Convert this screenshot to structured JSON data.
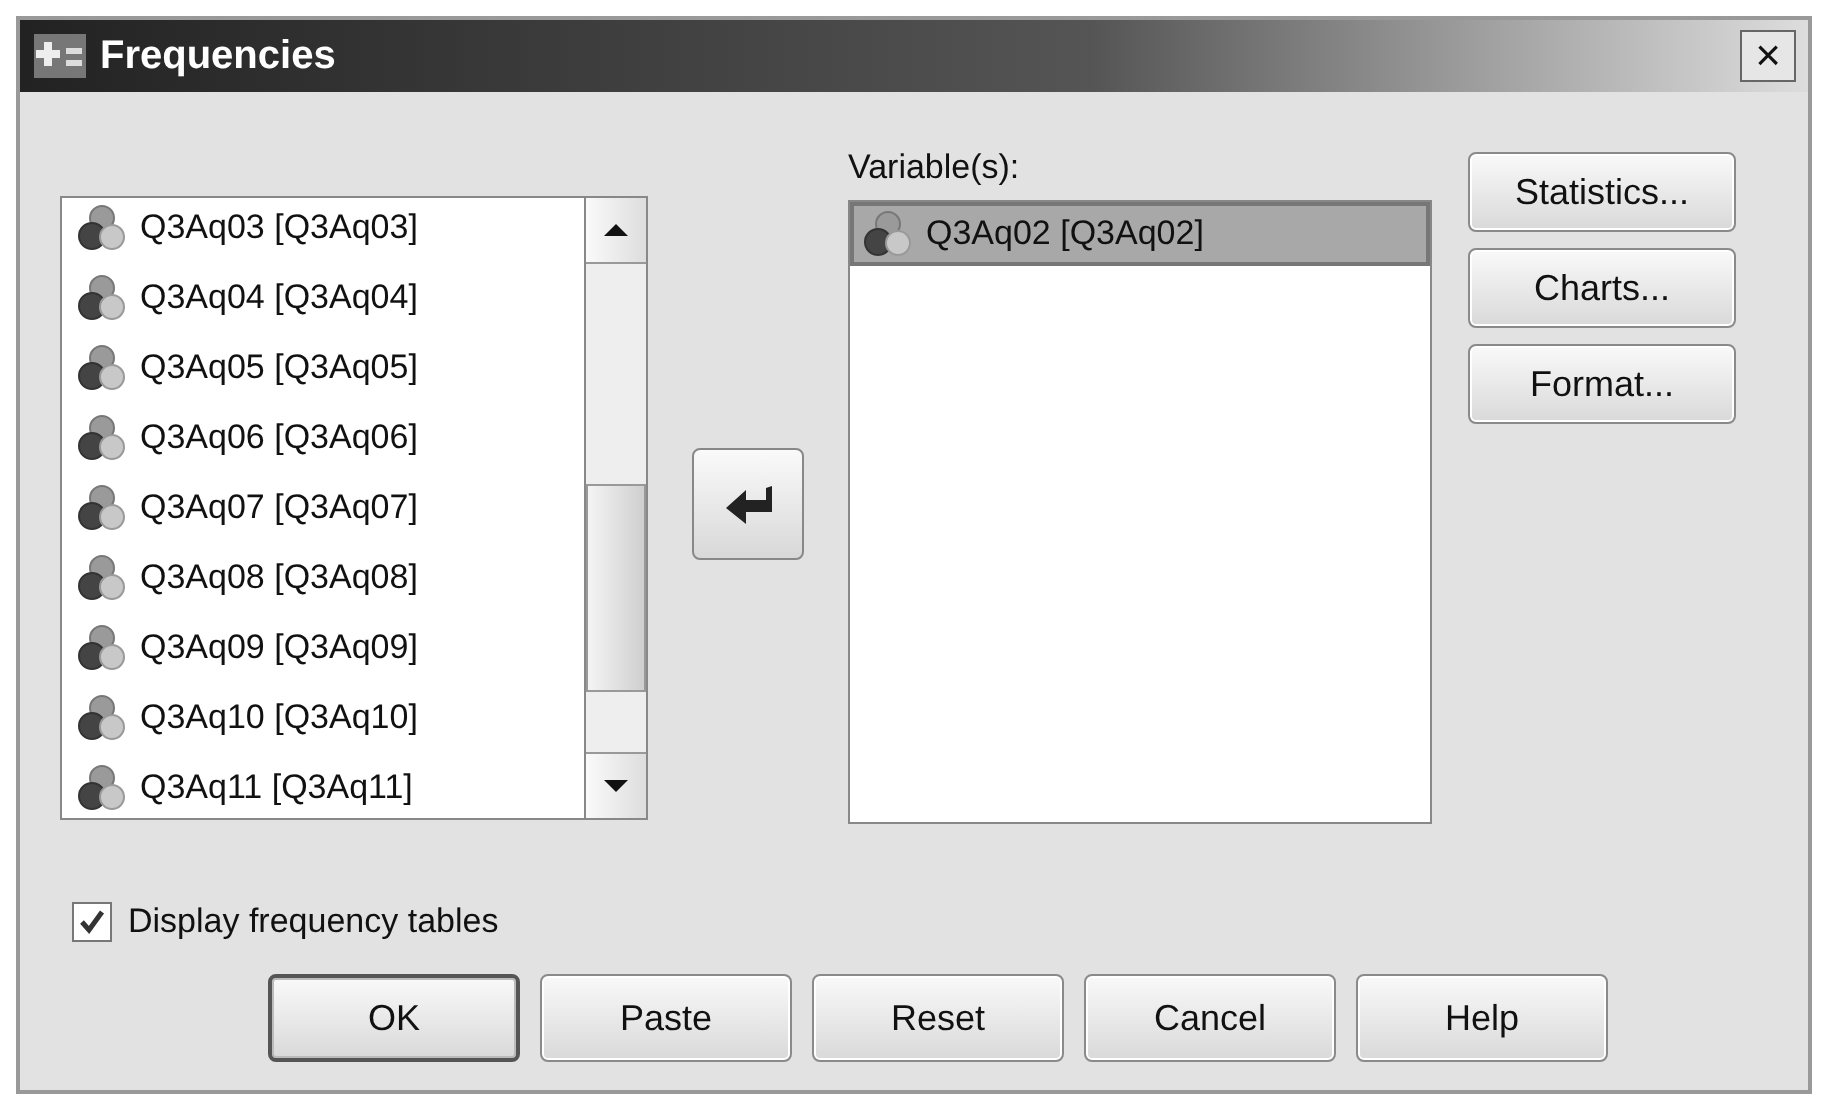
{
  "window": {
    "title": "Frequencies",
    "close": "×"
  },
  "source_list": {
    "items": [
      {
        "label": "Q3Aq03 [Q3Aq03]",
        "selected": false
      },
      {
        "label": "Q3Aq04 [Q3Aq04]",
        "selected": false
      },
      {
        "label": "Q3Aq05 [Q3Aq05]",
        "selected": false
      },
      {
        "label": "Q3Aq06 [Q3Aq06]",
        "selected": false
      },
      {
        "label": "Q3Aq07 [Q3Aq07]",
        "selected": false
      },
      {
        "label": "Q3Aq08 [Q3Aq08]",
        "selected": false
      },
      {
        "label": "Q3Aq09 [Q3Aq09]",
        "selected": false
      },
      {
        "label": "Q3Aq10 [Q3Aq10]",
        "selected": false
      },
      {
        "label": "Q3Aq11 [Q3Aq11]",
        "selected": false
      }
    ]
  },
  "variables": {
    "label": "Variable(s):",
    "items": [
      {
        "label": "Q3Aq02 [Q3Aq02]",
        "selected": true
      }
    ]
  },
  "side_buttons": [
    {
      "label": "Statistics..."
    },
    {
      "label": "Charts..."
    },
    {
      "label": "Format..."
    }
  ],
  "display_frequency_tables": {
    "label": "Display frequency tables",
    "checked": true
  },
  "buttons": [
    {
      "label": "OK",
      "default": true
    },
    {
      "label": "Paste",
      "default": false
    },
    {
      "label": "Reset",
      "default": false
    },
    {
      "label": "Cancel",
      "default": false
    },
    {
      "label": "Help",
      "default": false
    }
  ]
}
